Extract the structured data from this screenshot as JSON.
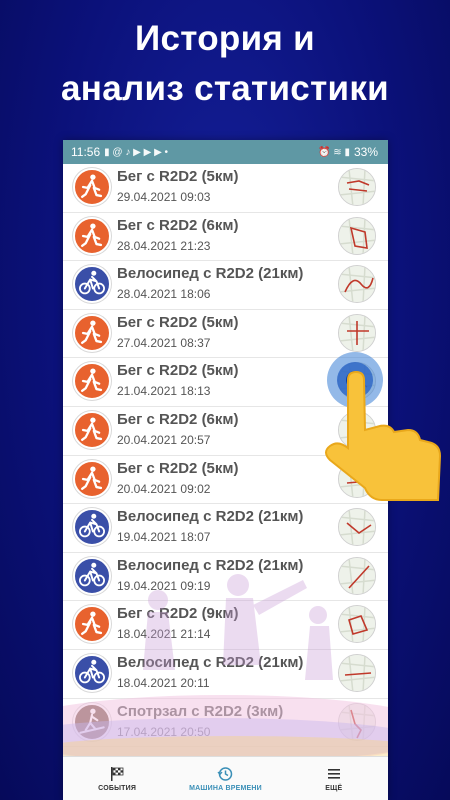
{
  "headline": {
    "line1": "История и",
    "line2": "анализ статистики"
  },
  "status_bar": {
    "time": "11:56",
    "battery": "33%",
    "left_icons": "▮ @ ♪ ▶ ▶ ▶ •",
    "right_icons": "⏰ ≋ ▮"
  },
  "colors": {
    "run": "#e8622e",
    "bike": "#3a4fa8",
    "gym": "#7a5a4a",
    "status_bar": "#5f98a4",
    "active_tab": "#3a8fb7"
  },
  "activities": [
    {
      "title": "Бег с R2D2 (5км)",
      "date": "29.04.2021 09:03",
      "kind": "run"
    },
    {
      "title": "Бег с R2D2 (6км)",
      "date": "28.04.2021 21:23",
      "kind": "run"
    },
    {
      "title": "Велосипед с R2D2 (21км)",
      "date": "28.04.2021 18:06",
      "kind": "bike"
    },
    {
      "title": "Бег с R2D2 (5км)",
      "date": "27.04.2021 08:37",
      "kind": "run"
    },
    {
      "title": "Бег с R2D2 (5км)",
      "date": "21.04.2021 18:13",
      "kind": "run"
    },
    {
      "title": "Бег с R2D2 (6км)",
      "date": "20.04.2021 20:57",
      "kind": "run"
    },
    {
      "title": "Бег с R2D2 (5км)",
      "date": "20.04.2021 09:02",
      "kind": "run"
    },
    {
      "title": "Велосипед с R2D2 (21км)",
      "date": "19.04.2021 18:07",
      "kind": "bike"
    },
    {
      "title": "Велосипед с R2D2 (21км)",
      "date": "19.04.2021 09:19",
      "kind": "bike"
    },
    {
      "title": "Бег с R2D2 (9км)",
      "date": "18.04.2021 21:14",
      "kind": "run"
    },
    {
      "title": "Велосипед с R2D2 (21км)",
      "date": "18.04.2021 20:11",
      "kind": "bike"
    },
    {
      "title": "Спотрзал с R2D2 (3км)",
      "date": "17.04.2021 20:50",
      "kind": "gym"
    }
  ],
  "nav": {
    "events": "СОБЫТИЯ",
    "time_machine": "МАШИНА ВРЕМЕНИ",
    "more": "ЕЩЁ"
  }
}
